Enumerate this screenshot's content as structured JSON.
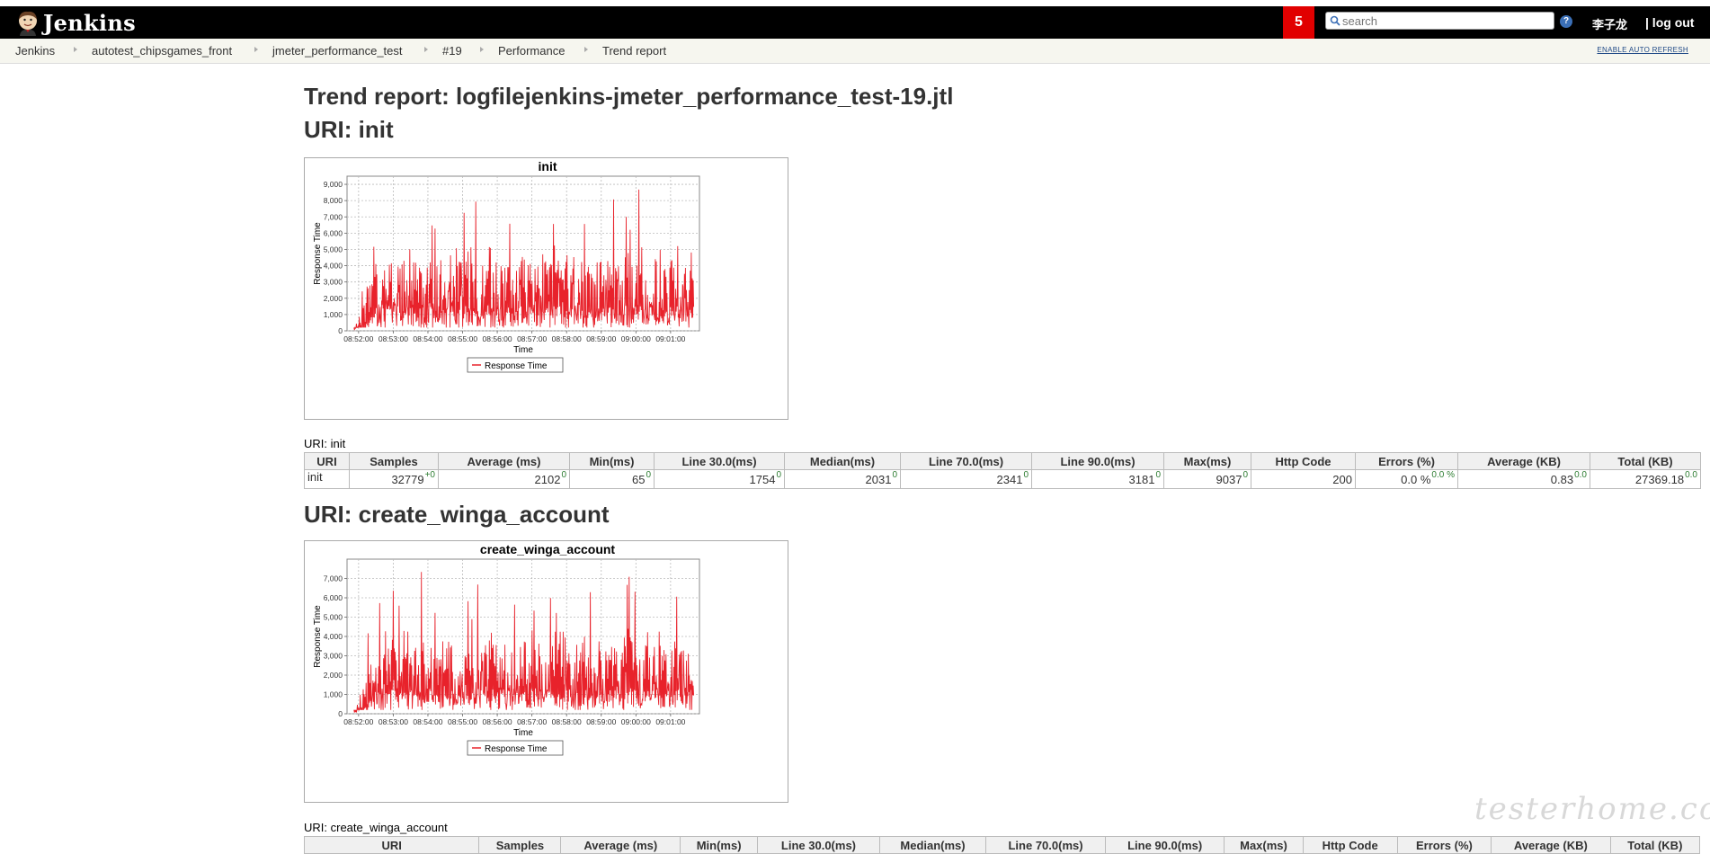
{
  "header": {
    "logo_text": "Jenkins",
    "notification_count": "5",
    "search_placeholder": "search",
    "user_name": "李子龙",
    "logout_label": "| log out",
    "accent_color": "#e10000"
  },
  "breadcrumb": {
    "items": [
      "Jenkins",
      "autotest_chipsgames_front",
      "jmeter_performance_test",
      "#19",
      "Performance",
      "Trend report"
    ],
    "auto_refresh": "ENABLE AUTO REFRESH"
  },
  "page_title": "Trend report: logfilejenkins-jmeter_performance_test-19.jtl",
  "sections": [
    {
      "heading": "URI: init",
      "caption": "URI: init",
      "table": {
        "headers": [
          "URI",
          "Samples",
          "Average (ms)",
          "Min(ms)",
          "Line 30.0(ms)",
          "Median(ms)",
          "Line 70.0(ms)",
          "Line 90.0(ms)",
          "Max(ms)",
          "Http Code",
          "Errors (%)",
          "Average (KB)",
          "Total (KB)"
        ],
        "row": {
          "uri": "init",
          "samples": "32779",
          "samples_diff": "+0",
          "average": "2102",
          "average_diff": "0",
          "min": "65",
          "min_diff": "0",
          "line30": "1754",
          "line30_diff": "0",
          "median": "2031",
          "median_diff": "0",
          "line70": "2341",
          "line70_diff": "0",
          "line90": "3181",
          "line90_diff": "0",
          "max": "9037",
          "max_diff": "0",
          "http_code": "200",
          "errors": "0.0 %",
          "errors_diff": "0.0 %",
          "avg_kb": "0.83",
          "avg_kb_diff": "0.0",
          "total_kb": "27369.18",
          "total_kb_diff": "0.0"
        }
      }
    },
    {
      "heading": "URI: create_winga_account",
      "caption": "URI: create_winga_account",
      "table": {
        "headers": [
          "URI",
          "Samples",
          "Average (ms)",
          "Min(ms)",
          "Line 30.0(ms)",
          "Median(ms)",
          "Line 70.0(ms)",
          "Line 90.0(ms)",
          "Max(ms)",
          "Http Code",
          "Errors (%)",
          "Average (KB)",
          "Total (KB)"
        ]
      }
    }
  ],
  "chart_data": [
    {
      "type": "line",
      "title": "init",
      "xlabel": "Time",
      "ylabel": "Response Time",
      "x_ticks": [
        "08:52:00",
        "08:53:00",
        "08:54:00",
        "08:55:00",
        "08:56:00",
        "08:57:00",
        "08:58:00",
        "08:59:00",
        "09:00:00",
        "09:01:00"
      ],
      "y_ticks": [
        "0",
        "1,000",
        "2,000",
        "3,000",
        "4,000",
        "5,000",
        "6,000",
        "7,000",
        "8,000",
        "9,000"
      ],
      "ylim": [
        0,
        9500
      ],
      "xlim": [
        "08:51:40",
        "09:01:50"
      ],
      "grid": true,
      "legend": "bottom-center",
      "series": [
        {
          "name": "Response Time",
          "color": "#e8222b",
          "min": 65,
          "median": 2031,
          "line90": 3181,
          "max": 9037,
          "samples": 32779
        }
      ]
    },
    {
      "type": "line",
      "title": "create_winga_account",
      "xlabel": "Time",
      "ylabel": "Response Time",
      "x_ticks": [
        "08:52:00",
        "08:53:00",
        "08:54:00",
        "08:55:00",
        "08:56:00",
        "08:57:00",
        "08:58:00",
        "08:59:00",
        "09:00:00",
        "09:01:00"
      ],
      "y_ticks": [
        "0",
        "1,000",
        "2,000",
        "3,000",
        "4,000",
        "5,000",
        "6,000",
        "7,000"
      ],
      "ylim": [
        0,
        8000
      ],
      "xlim": [
        "08:51:40",
        "09:01:50"
      ],
      "grid": true,
      "legend": "bottom-center",
      "series": [
        {
          "name": "Response Time",
          "color": "#e8222b",
          "peak": 7500
        }
      ]
    }
  ],
  "watermark": "testerhome.com"
}
